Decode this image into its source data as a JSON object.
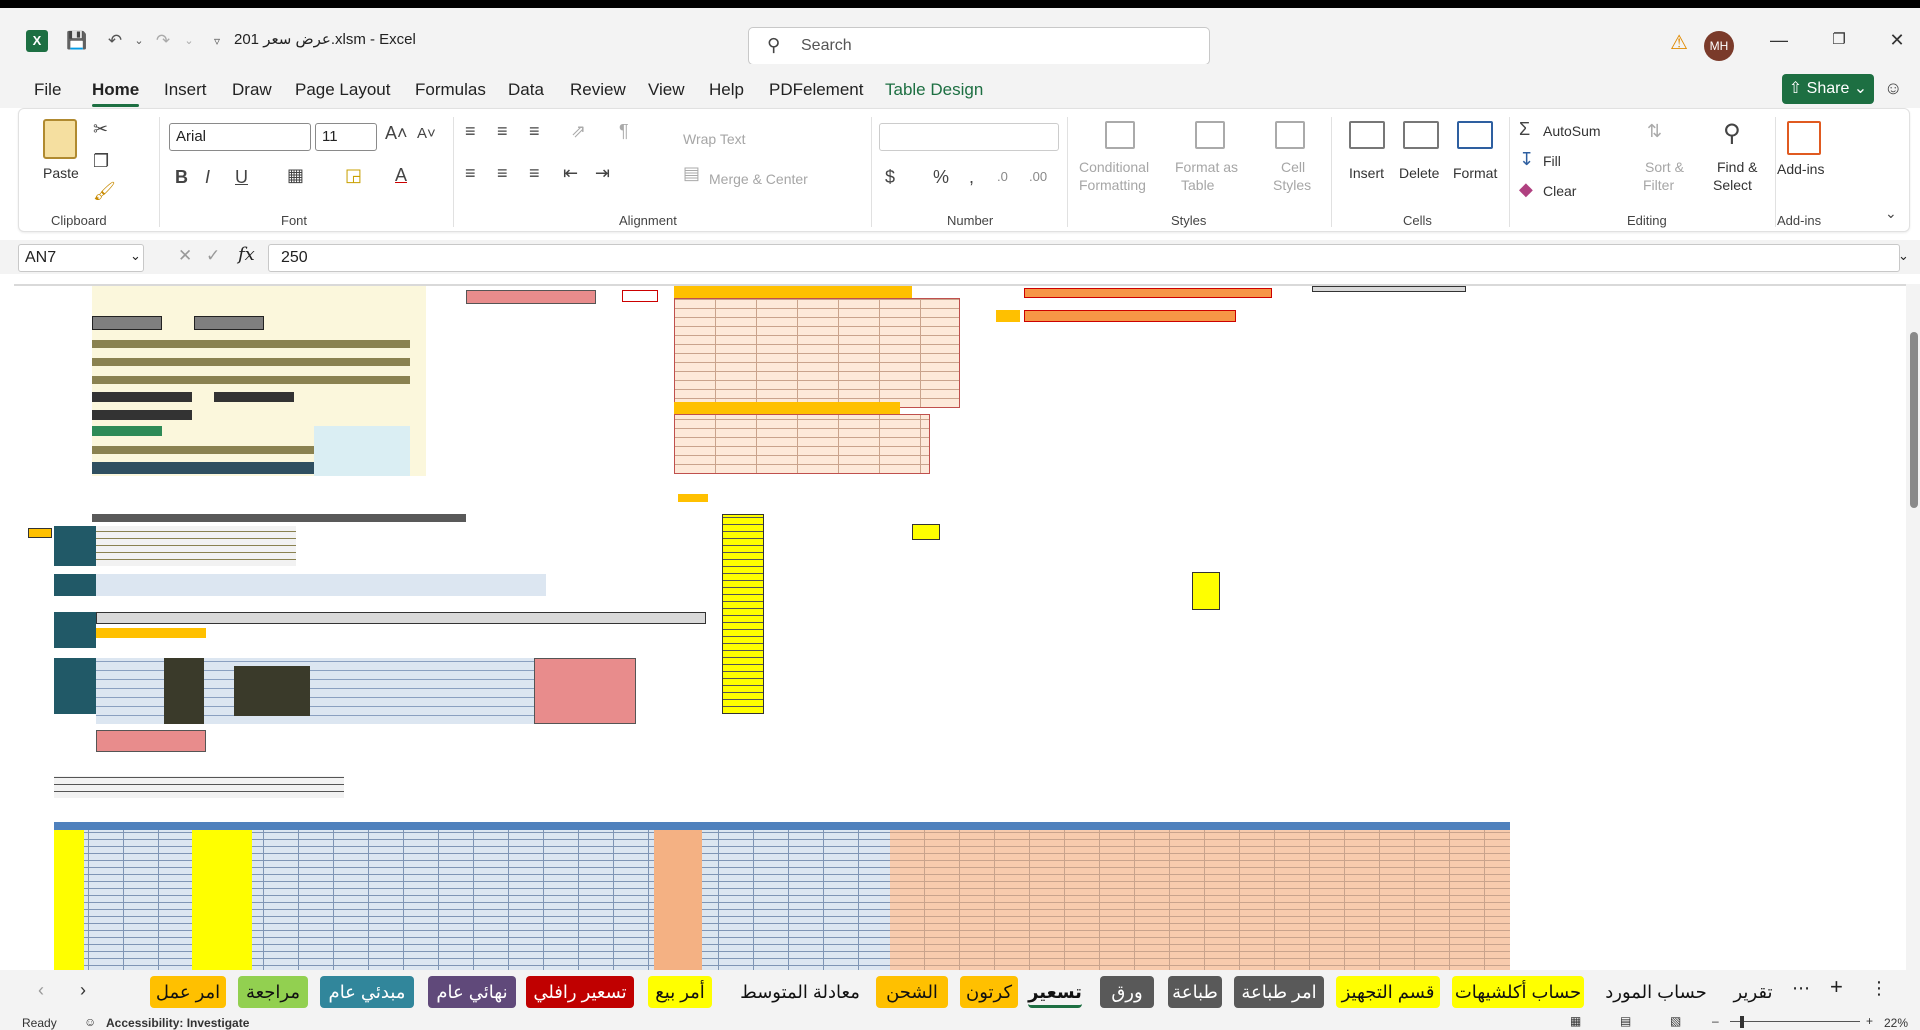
{
  "window": {
    "title": "201 عرض سعر.xlsm  -  Excel",
    "user_initials": "MH"
  },
  "search": {
    "placeholder": "Search"
  },
  "menu": {
    "tabs": [
      "File",
      "Home",
      "Insert",
      "Draw",
      "Page Layout",
      "Formulas",
      "Data",
      "Review",
      "View",
      "Help",
      "PDFelement",
      "Table Design"
    ],
    "share_label": "Share"
  },
  "ribbon": {
    "clipboard": {
      "paste": "Paste",
      "label": "Clipboard"
    },
    "font": {
      "family": "Arial",
      "size": "11",
      "label": "Font"
    },
    "alignment": {
      "wrap": "Wrap Text",
      "merge": "Merge & Center",
      "label": "Alignment"
    },
    "number": {
      "label": "Number"
    },
    "styles": {
      "cond1": "Conditional",
      "cond2": "Formatting",
      "fmt1": "Format as",
      "fmt2": "Table",
      "cell1": "Cell",
      "cell2": "Styles",
      "label": "Styles"
    },
    "cells": {
      "insert": "Insert",
      "delete": "Delete",
      "format": "Format",
      "label": "Cells"
    },
    "editing": {
      "autosum": "AutoSum",
      "fill": "Fill",
      "clear": "Clear",
      "sort1": "Sort &",
      "sort2": "Filter",
      "find1": "Find &",
      "find2": "Select",
      "label": "Editing"
    },
    "addins": {
      "btn": "Add-ins",
      "label": "Add-ins"
    }
  },
  "formula_bar": {
    "name_box": "AN7",
    "formula": "250"
  },
  "sheet_tabs": [
    {
      "label": "امر عمل",
      "color": "#ffc000"
    },
    {
      "label": "مراجعة",
      "color": "#92d050"
    },
    {
      "label": "مبدئي عام",
      "color": "#31869b"
    },
    {
      "label": "نهائي عام",
      "color": "#60497a"
    },
    {
      "label": "تسعير رافلي",
      "color": "#c00000"
    },
    {
      "label": "أمر بيع",
      "color": "#ffff00"
    },
    {
      "label": "معادلة المتوسط",
      "color": ""
    },
    {
      "label": "الشحن",
      "color": "#ffc000"
    },
    {
      "label": "كرتون",
      "color": "#ffc000"
    },
    {
      "label": "تسعير",
      "color": ""
    },
    {
      "label": "ورق",
      "color": "#595959"
    },
    {
      "label": "طباعة",
      "color": "#595959"
    },
    {
      "label": "امر طباعة",
      "color": "#595959"
    },
    {
      "label": "قسم التجهيز",
      "color": "#ffff00"
    },
    {
      "label": "حساب أكلشيهات",
      "color": "#ffff00"
    },
    {
      "label": "حساب المورد",
      "color": ""
    },
    {
      "label": "تقرير",
      "color": ""
    }
  ],
  "status": {
    "ready": "Ready",
    "accessibility": "Accessibility: Investigate",
    "zoom": "22%"
  }
}
